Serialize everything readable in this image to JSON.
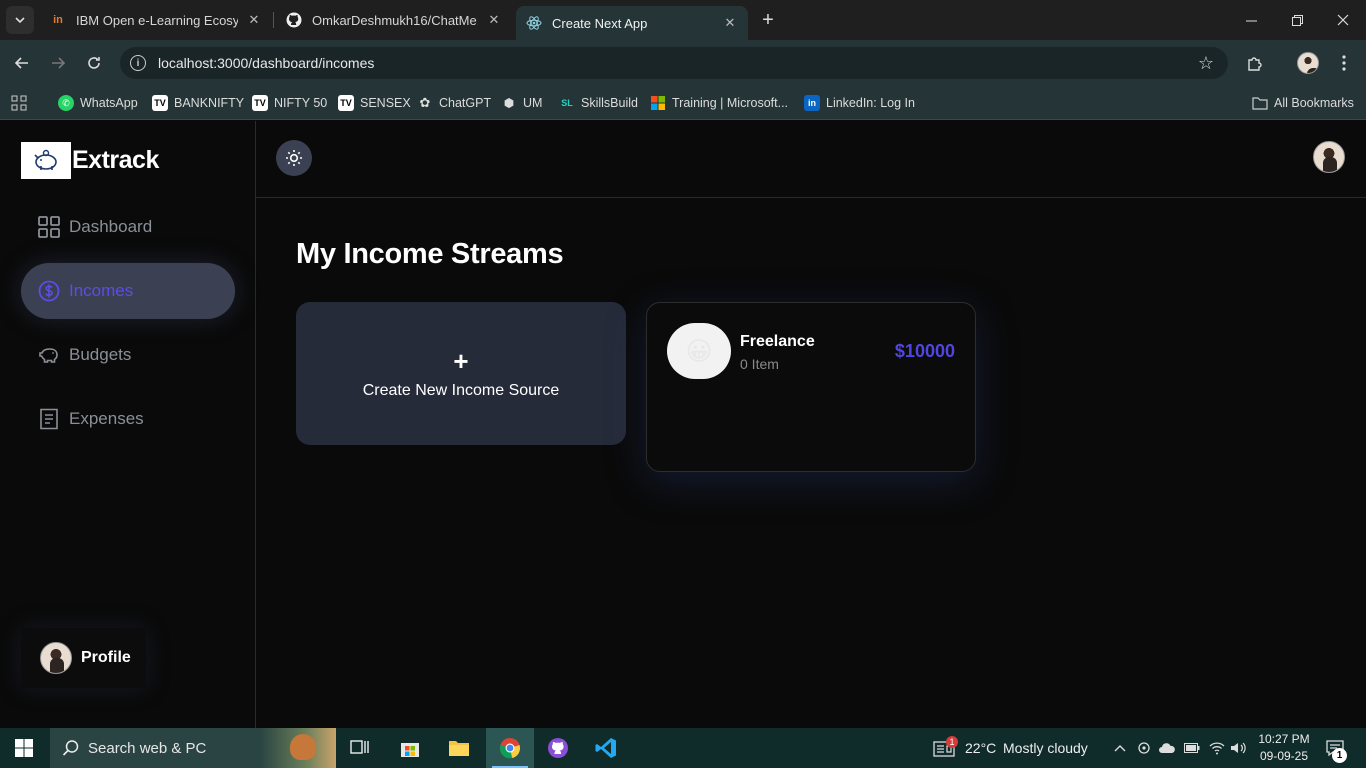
{
  "browser": {
    "tabs": [
      {
        "title": "IBM Open e-Learning Ecosystem",
        "active": false
      },
      {
        "title": "OmkarDeshmukh16/ChatMe: Full",
        "active": false
      },
      {
        "title": "Create Next App",
        "active": true
      }
    ],
    "address": "localhost:3000/dashboard/incomes",
    "bookmarks": [
      "WhatsApp",
      "BANKNIFTY",
      "NIFTY 50",
      "SENSEX",
      "ChatGPT",
      "UM",
      "SkillsBuild",
      "Training | Microsoft...",
      "LinkedIn: Log In"
    ],
    "all_bookmarks": "All Bookmarks"
  },
  "app": {
    "brand": "Extrack",
    "nav": [
      {
        "label": "Dashboard",
        "icon": "dashboard-grid-icon",
        "active": false
      },
      {
        "label": "Incomes",
        "icon": "dollar-circle-icon",
        "active": true
      },
      {
        "label": "Budgets",
        "icon": "piggy-bank-icon",
        "active": false
      },
      {
        "label": "Expenses",
        "icon": "receipt-icon",
        "active": false
      }
    ],
    "profile_label": "Profile",
    "page_title": "My Income Streams",
    "create_card": {
      "plus": "+",
      "label": "Create New Income Source"
    },
    "incomes": [
      {
        "emoji": "😀",
        "name": "Freelance",
        "items": "0 Item",
        "amount": "$10000"
      }
    ],
    "colors": {
      "accent": "#5145e0",
      "active_nav_bg": "#3b4152",
      "card_bg": "#262b3a"
    }
  },
  "taskbar": {
    "search_placeholder": "Search web & PC",
    "weather_temp": "22°C",
    "weather_desc": "Mostly cloudy",
    "weather_badge": "1",
    "time": "10:27 PM",
    "date": "09-09-25",
    "notif_count": "1"
  }
}
